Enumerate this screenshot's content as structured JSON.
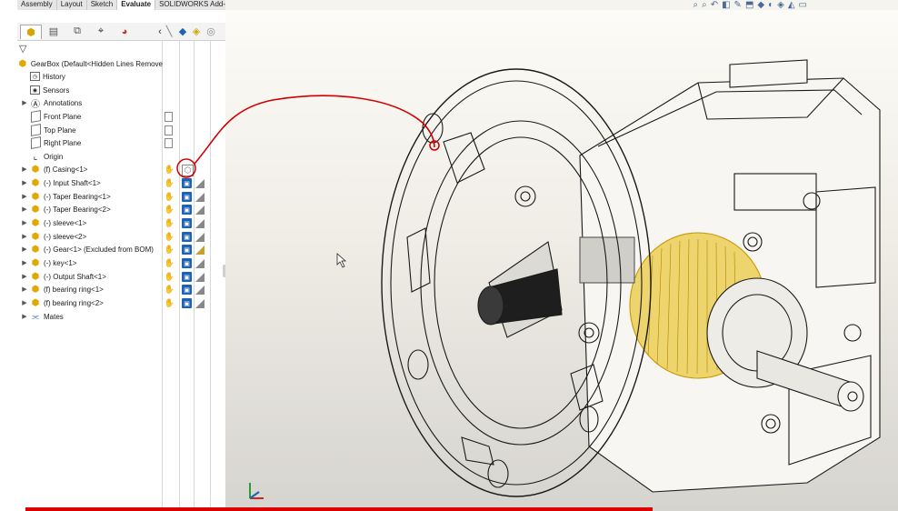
{
  "command_tabs": [
    "Assembly",
    "Layout",
    "Sketch",
    "Evaluate",
    "SOLIDWORKS Add-Ins"
  ],
  "active_tab": "Evaluate",
  "panel_tab_icons": [
    "feature-manager-icon",
    "property-manager-icon",
    "configuration-manager-icon",
    "dimxpert-icon",
    "display-manager-icon"
  ],
  "tree": {
    "root": "GearBox  (Default<Hidden Lines Remove",
    "items": [
      {
        "label": "History",
        "icon": "history-icon",
        "expander": false
      },
      {
        "label": "Sensors",
        "icon": "sensors-icon",
        "expander": false
      },
      {
        "label": "Annotations",
        "icon": "annotations-icon",
        "expander": true
      },
      {
        "label": "Front Plane",
        "icon": "plane-icon",
        "expander": false
      },
      {
        "label": "Top Plane",
        "icon": "plane-icon",
        "expander": false
      },
      {
        "label": "Right Plane",
        "icon": "plane-icon",
        "expander": false
      },
      {
        "label": "Origin",
        "icon": "origin-icon",
        "expander": false
      },
      {
        "label": "(f) Casing<1>",
        "icon": "part-icon",
        "expander": true
      },
      {
        "label": "(-) Input Shaft<1>",
        "icon": "part-icon",
        "expander": true
      },
      {
        "label": "(-) Taper Bearing<1>",
        "icon": "part-icon",
        "expander": true
      },
      {
        "label": "(-) Taper Bearing<2>",
        "icon": "part-icon",
        "expander": true
      },
      {
        "label": "(-) sleeve<1>",
        "icon": "part-icon",
        "expander": true
      },
      {
        "label": "(-) sleeve<2>",
        "icon": "part-icon",
        "expander": true
      },
      {
        "label": "(-) Gear<1> (Excluded from BOM)",
        "icon": "part-icon",
        "expander": true
      },
      {
        "label": "(-) key<1>",
        "icon": "part-icon",
        "expander": true
      },
      {
        "label": "(-) Output Shaft<1>",
        "icon": "part-icon",
        "expander": true
      },
      {
        "label": "(f) bearing ring<1>",
        "icon": "part-icon",
        "expander": true
      },
      {
        "label": "(f) bearing ring<2>",
        "icon": "part-icon",
        "expander": true
      },
      {
        "label": "Mates",
        "icon": "mates-icon",
        "expander": true
      }
    ]
  },
  "colors": {
    "accent_blue": "#1c63b8",
    "part_yellow": "#e0a800",
    "annotation_red": "#d00000",
    "gear_highlight": "#e6b800"
  }
}
